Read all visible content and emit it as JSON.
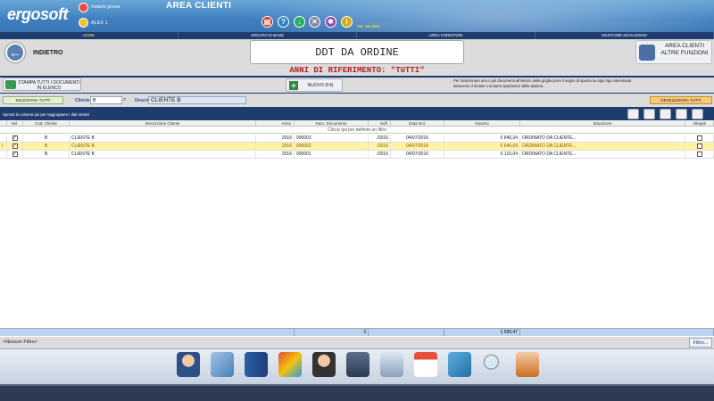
{
  "app": {
    "logo": "ergosoft",
    "logo_sub": "",
    "title": "AREA CLIENTI",
    "version": "Ver. 16.0600"
  },
  "user": {
    "name": "rosario prova",
    "company": "ALEX 1"
  },
  "toolbar_icons": [
    "printer-icon",
    "help-icon",
    "download-icon",
    "close-icon",
    "settings-icon",
    "info-icon"
  ],
  "nav": [
    "HOME",
    "ARCHIVI DI BASE",
    "AREA FORNITORI",
    "GESTIONE MAGAZZINO"
  ],
  "header": {
    "back": "INDIETRO",
    "title": "DDT DA ORDINE",
    "area_btn": "AREA CLIENTI ALTRE FUNZIONI"
  },
  "reference": "ANNI DI RIFERIMENTO: \"TUTTI\"",
  "buttons": {
    "print_all": "STAMPA TUTTI I DOCUMENTI IN ELENCO",
    "new": "NUOVO (F4)",
    "select_all": "SELEZIONA TUTTI",
    "deselect_all": "DESELEZIONA TUTTI",
    "filter": "Filtro..."
  },
  "info": "Per Selezionare uno o più documenti all'interno della griglia porre il segno di spunta su ogni riga interessata attraverso il mouse o la barra spaziatrice della tastiera",
  "filters": {
    "cliente_label": "Cliente",
    "cliente_value": "B",
    "desc_label": "Descrizione",
    "desc_value": "CLIENTE B"
  },
  "grid": {
    "group_hint": "Sposta la colonna qui per raggruppare i dati relativi",
    "filter_row": "Clicca qui per definire un filtro",
    "columns": [
      "Sel.",
      "Cod. Cliente",
      "Descrizione Cliente",
      "Anno",
      "Num. Documento",
      "Suff.",
      "Data Doc",
      "Importo",
      "Situazione",
      "Allegati"
    ],
    "rows": [
      {
        "sel": "✓",
        "cod": "B",
        "desc": "CLIENTE B",
        "anno": "2016",
        "num": "000003",
        "suff": "/2016",
        "data": "04/07/2016",
        "importo": "€ 840,34",
        "situazione": "ORDINATO DA CLIENTE...",
        "selected": false
      },
      {
        "sel": "✓",
        "cod": "B",
        "desc": "CLIENTE B",
        "anno": "2016",
        "num": "000002",
        "suff": "/2016",
        "data": "04/07/2016",
        "importo": "€ 640,09",
        "situazione": "ORDINATO DA CLIENTE...",
        "selected": true
      },
      {
        "sel": "✓",
        "cod": "B",
        "desc": "CLIENTE B",
        "anno": "2016",
        "num": "000001",
        "suff": "/2016",
        "data": "04/07/2016",
        "importo": "€ 110,04",
        "situazione": "ORDINATO DA CLIENTE...",
        "selected": false
      }
    ],
    "footer": {
      "count": "3",
      "total": "1.590,47"
    }
  },
  "no_filter": "<Nessun Filtro>",
  "dock_icons": [
    "user-icon",
    "card-icon",
    "binder-icon",
    "box-icon",
    "lock-user-icon",
    "save-icon",
    "printer-icon",
    "calendar-icon",
    "tag-icon",
    "search-icon",
    "settings-icon"
  ],
  "colors": {
    "accent": "#1f3c6e",
    "selected_row": "#fff4a3",
    "reference": "#b21f1f"
  }
}
